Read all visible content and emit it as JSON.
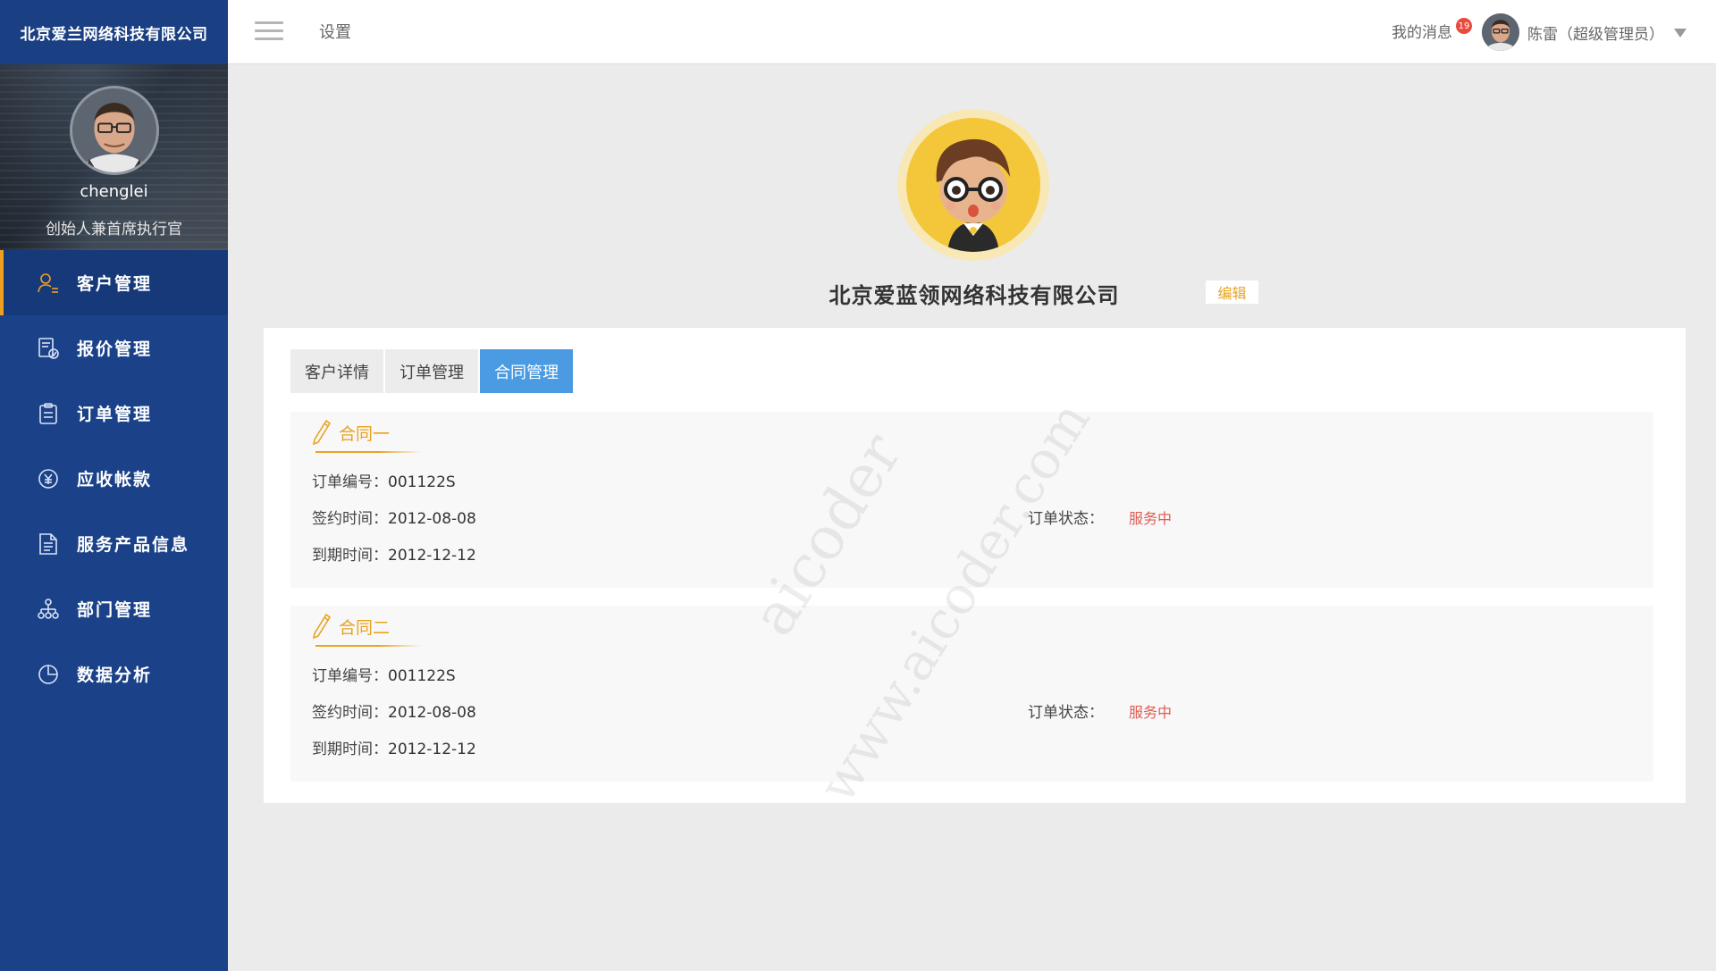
{
  "sidebar": {
    "brand": "北京爱兰网络科技有限公司",
    "profile": {
      "username": "chenglei",
      "role": "创始人兼首席执行官"
    },
    "items": [
      {
        "label": "客户管理",
        "icon": "customer-icon",
        "active": true
      },
      {
        "label": "报价管理",
        "icon": "quote-icon"
      },
      {
        "label": "订单管理",
        "icon": "order-clipboard-icon"
      },
      {
        "label": "应收帐款",
        "icon": "yen-coin-icon"
      },
      {
        "label": "服务产品信息",
        "icon": "document-icon"
      },
      {
        "label": "部门管理",
        "icon": "org-chart-icon"
      },
      {
        "label": "数据分析",
        "icon": "pie-chart-icon"
      }
    ]
  },
  "topbar": {
    "breadcrumb": "设置",
    "messages_label": "我的消息",
    "messages_count": "19",
    "user_name": "陈雷（超级管理员）"
  },
  "company": {
    "name": "北京爱蓝领网络科技有限公司",
    "edit_label": "编辑"
  },
  "tabs": [
    {
      "label": "客户详情"
    },
    {
      "label": "订单管理"
    },
    {
      "label": "合同管理",
      "active": true
    }
  ],
  "contracts": [
    {
      "title": "合同一",
      "order_no_label": "订单编号：",
      "order_no": "001122S",
      "sign_label": "签约时间：",
      "sign_date": "2012-08-08",
      "expire_label": "到期时间：",
      "expire_date": "2012-12-12",
      "status_label": "订单状态：",
      "status": "服务中"
    },
    {
      "title": "合同二",
      "order_no_label": "订单编号：",
      "order_no": "001122S",
      "sign_label": "签约时间：",
      "sign_date": "2012-08-08",
      "expire_label": "到期时间：",
      "expire_date": "2012-12-12",
      "status_label": "订单状态：",
      "status": "服务中"
    }
  ],
  "watermark": {
    "line1": "aicoder",
    "line2": "www.aicoder.com"
  },
  "colors": {
    "sidebar_bg": "#1b4289",
    "accent": "#e9a320",
    "tab_active": "#4a9be2",
    "status_red": "#e05a4f"
  }
}
